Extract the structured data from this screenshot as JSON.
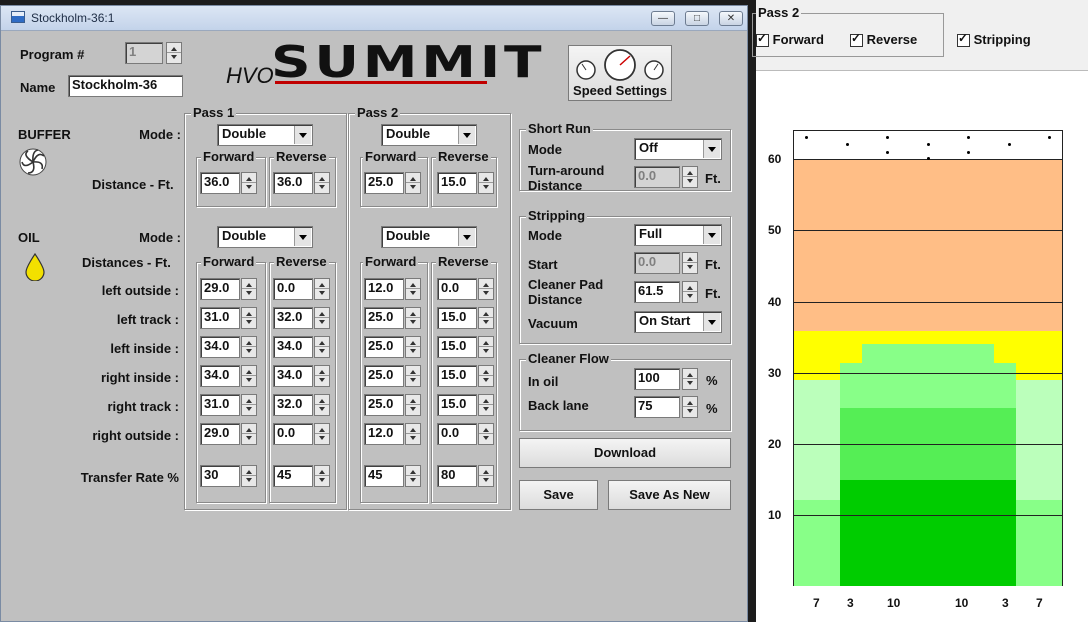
{
  "window": {
    "title": "Stockholm-36:1"
  },
  "header": {
    "program_label": "Program #",
    "program_value": "1",
    "name_label": "Name",
    "name_value": "Stockholm-36"
  },
  "logo": {
    "prefix": "HVO",
    "brand": "SUMMIT"
  },
  "speed_settings": {
    "label": "Speed Settings"
  },
  "pass1": {
    "label": "Pass 1",
    "buffer_mode": "Double",
    "oil_mode": "Double"
  },
  "pass2": {
    "label": "Pass 2",
    "buffer_mode": "Double",
    "oil_mode": "Double"
  },
  "buffer": {
    "label": "BUFFER",
    "mode_label": "Mode :",
    "distance_label": "Distance - Ft.",
    "p1_forward": "36.0",
    "p1_reverse": "36.0",
    "p2_forward": "25.0",
    "p2_reverse": "15.0"
  },
  "oil": {
    "label": "OIL",
    "mode_label": "Mode :",
    "distances_label": "Distances - Ft.",
    "transfer_label": "Transfer Rate %"
  },
  "col_labels": {
    "forward": "Forward",
    "reverse": "Reverse"
  },
  "oil_rows": [
    {
      "label": "left outside :",
      "p1f": "29.0",
      "p1r": "0.0",
      "p2f": "12.0",
      "p2r": "0.0"
    },
    {
      "label": "left track :",
      "p1f": "31.0",
      "p1r": "32.0",
      "p2f": "25.0",
      "p2r": "15.0"
    },
    {
      "label": "left inside :",
      "p1f": "34.0",
      "p1r": "34.0",
      "p2f": "25.0",
      "p2r": "15.0"
    },
    {
      "label": "right inside :",
      "p1f": "34.0",
      "p1r": "34.0",
      "p2f": "25.0",
      "p2r": "15.0"
    },
    {
      "label": "right track :",
      "p1f": "31.0",
      "p1r": "32.0",
      "p2f": "25.0",
      "p2r": "15.0"
    },
    {
      "label": "right outside :",
      "p1f": "29.0",
      "p1r": "0.0",
      "p2f": "12.0",
      "p2r": "0.0"
    }
  ],
  "transfer": {
    "p1f": "30",
    "p1r": "45",
    "p2f": "45",
    "p2r": "80"
  },
  "short_run": {
    "title": "Short Run",
    "mode_label": "Mode",
    "mode_value": "Off",
    "turnaround_label_1": "Turn-around",
    "turnaround_label_2": "Distance",
    "turnaround_value": "0.0",
    "unit": "Ft."
  },
  "stripping": {
    "title": "Stripping",
    "mode_label": "Mode",
    "mode_value": "Full",
    "start_label": "Start",
    "start_value": "0.0",
    "pad_label_1": "Cleaner Pad",
    "pad_label_2": "Distance",
    "pad_value": "61.5",
    "unit": "Ft.",
    "vacuum_label": "Vacuum",
    "vacuum_value": "On Start"
  },
  "cleaner_flow": {
    "title": "Cleaner Flow",
    "in_oil_label": "In oil",
    "in_oil_value": "100",
    "back_lane_label": "Back lane",
    "back_lane_value": "75",
    "unit": "%"
  },
  "buttons": {
    "download": "Download",
    "save": "Save",
    "save_as_new": "Save As New"
  },
  "right_panel": {
    "group_label": "Pass 2",
    "forward": "Forward",
    "reverse": "Reverse",
    "stripping": "Stripping"
  },
  "chart_data": {
    "type": "heatmap",
    "title": "",
    "y_ticks": [
      "10",
      "20",
      "30",
      "40",
      "50",
      "60"
    ],
    "x_ticks": [
      "7",
      "3",
      "10",
      "10",
      "3",
      "7"
    ],
    "colors": {
      "cleaner": "#ffbe86",
      "yellow": "#ffff00",
      "pale_green": "#bbffbb",
      "light_green": "#88ff88",
      "green": "#55ee55",
      "dark_green": "#00cc00"
    }
  }
}
